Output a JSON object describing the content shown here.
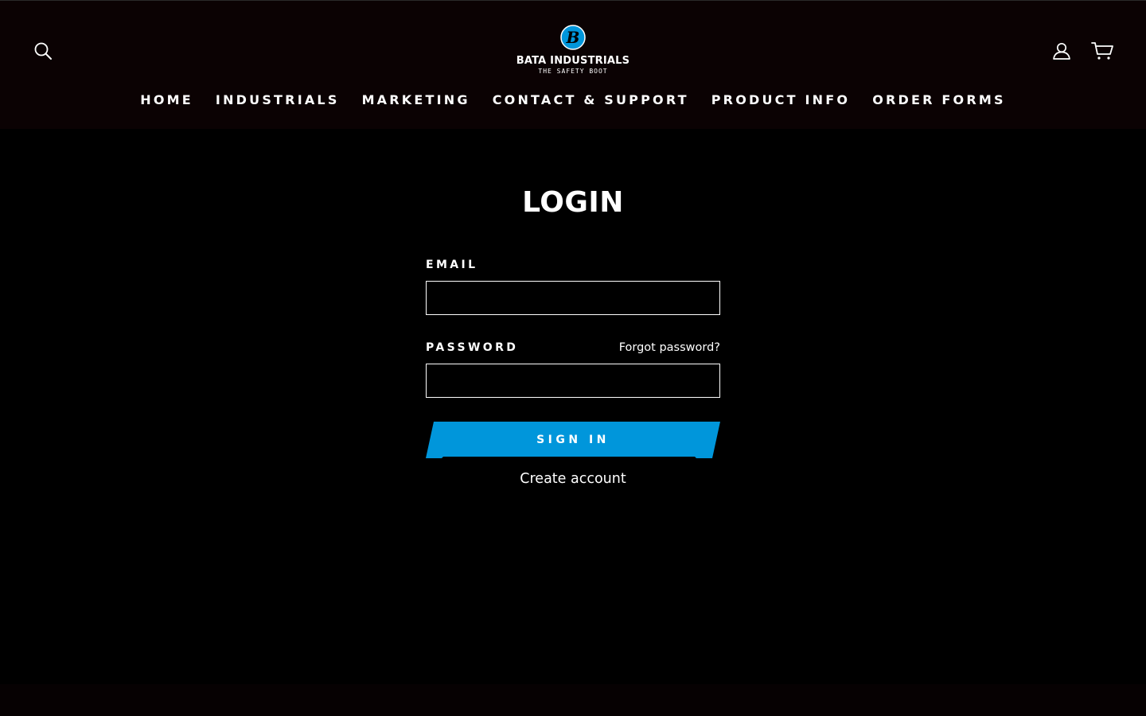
{
  "brand": {
    "name": "BATA INDUSTRIALS",
    "tagline": "THE SAFETY BOOT",
    "badge_letter": "B",
    "accent_color": "#0096db"
  },
  "header": {
    "left_icon": "search-icon",
    "right_icons": [
      "user-icon",
      "cart-icon"
    ]
  },
  "nav": {
    "items": [
      {
        "label": "HOME"
      },
      {
        "label": "INDUSTRIALS"
      },
      {
        "label": "MARKETING"
      },
      {
        "label": "CONTACT & SUPPORT"
      },
      {
        "label": "PRODUCT INFO"
      },
      {
        "label": "ORDER FORMS"
      }
    ]
  },
  "login": {
    "title": "LOGIN",
    "email_label": "EMAIL",
    "email_value": "",
    "password_label": "PASSWORD",
    "password_value": "",
    "forgot_label": "Forgot password?",
    "sign_in_label": "SIGN IN",
    "create_account_label": "Create account"
  },
  "colors": {
    "background": "#000000",
    "header_background": "#0b0203",
    "button": "#0096db",
    "text": "#ffffff"
  }
}
